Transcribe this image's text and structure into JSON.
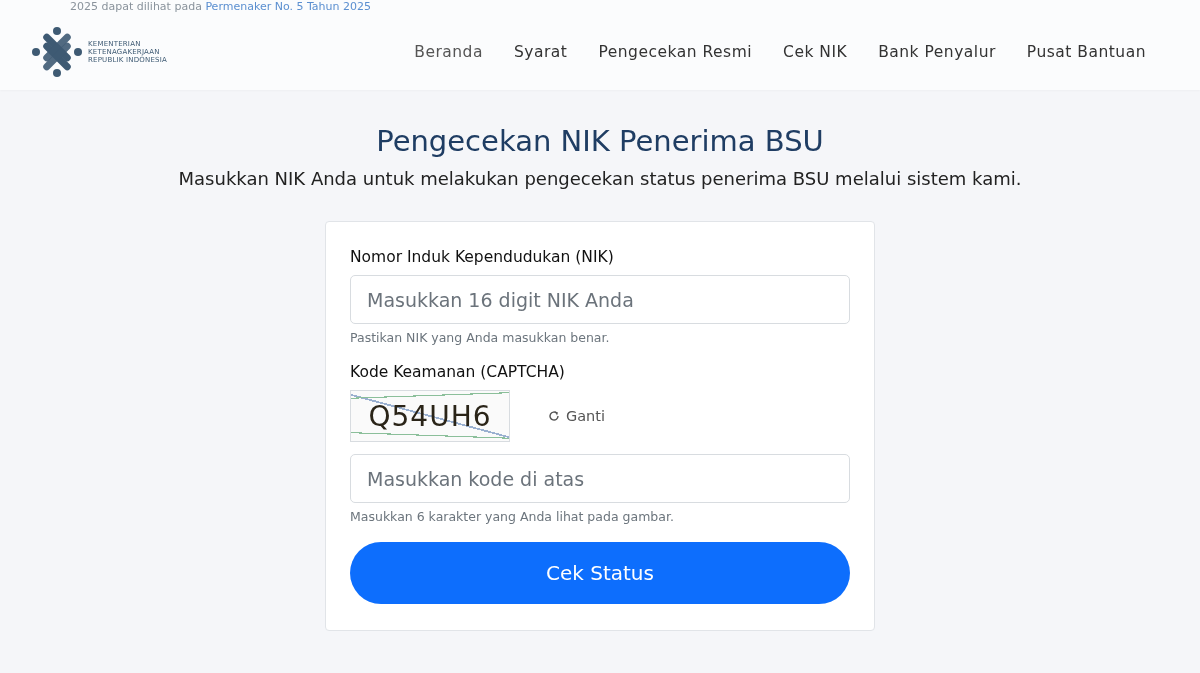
{
  "notice": {
    "text": "2025 dapat dilihat pada ",
    "link": "Permenaker No. 5 Tahun 2025"
  },
  "header": {
    "logo_lines": [
      "KEMENTERIAN",
      "KETENAGAKERJAAN",
      "REPUBLIK INDONESIA"
    ],
    "nav": [
      {
        "label": "Beranda",
        "selected": true
      },
      {
        "label": "Syarat",
        "selected": false
      },
      {
        "label": "Pengecekan Resmi",
        "selected": false
      },
      {
        "label": "Cek NIK",
        "selected": false
      },
      {
        "label": "Bank Penyalur",
        "selected": false
      },
      {
        "label": "Pusat Bantuan",
        "selected": false
      }
    ]
  },
  "title": "Pengecekan NIK Penerima BSU",
  "subtitle": "Masukkan NIK Anda untuk melakukan pengecekan status penerima BSU melalui sistem kami.",
  "form": {
    "nik": {
      "label": "Nomor Induk Kependudukan (NIK)",
      "placeholder": "Masukkan 16 digit NIK Anda",
      "help": "Pastikan NIK yang Anda masukkan benar."
    },
    "captcha": {
      "label": "Kode Keamanan (CAPTCHA)",
      "code": "Q54UH6",
      "refresh": "Ganti",
      "placeholder": "Masukkan kode di atas",
      "help": "Masukkan 6 karakter yang Anda lihat pada gambar."
    },
    "submit": "Cek Status"
  }
}
